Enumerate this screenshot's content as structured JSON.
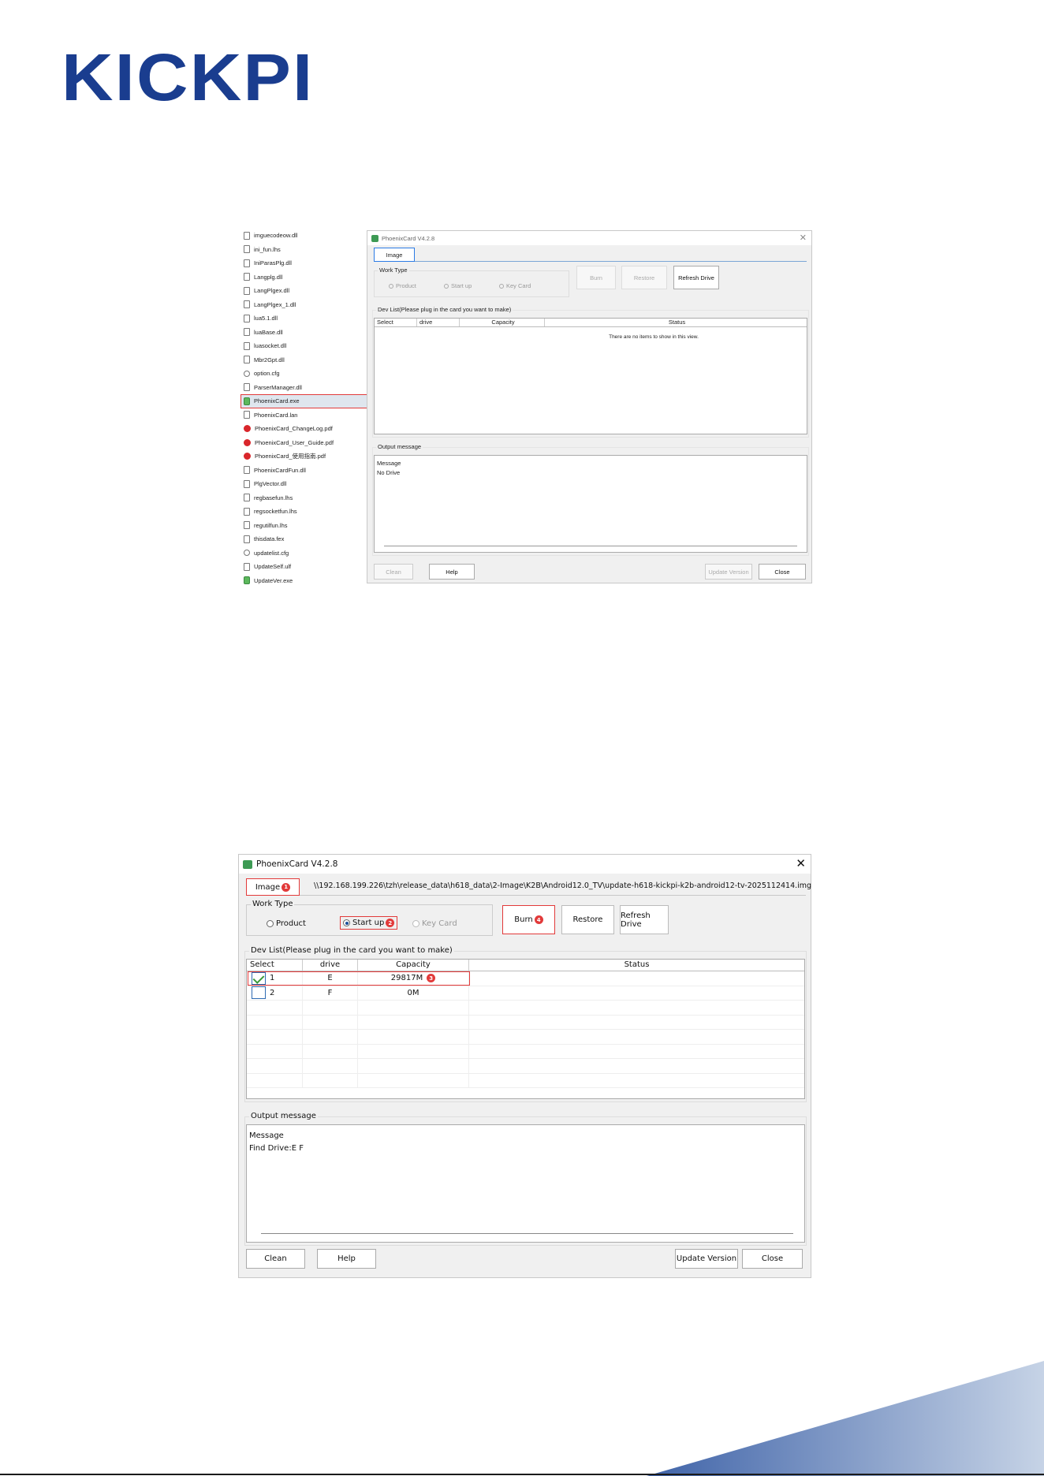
{
  "brand": {
    "logo_text": "KICKPI",
    "color": "#1a3d8f"
  },
  "explorer": {
    "files": [
      {
        "name": "imguecodeow.dll",
        "icon": "dll-file-icon"
      },
      {
        "name": "ini_fun.lhs",
        "icon": "file-icon"
      },
      {
        "name": "IniParasPlg.dll",
        "icon": "dll-file-icon"
      },
      {
        "name": "Langplg.dll",
        "icon": "dll-file-icon"
      },
      {
        "name": "LangPlgex.dll",
        "icon": "dll-file-icon"
      },
      {
        "name": "LangPlgex_1.dll",
        "icon": "dll-file-icon"
      },
      {
        "name": "lua5.1.dll",
        "icon": "dll-file-icon"
      },
      {
        "name": "luaBase.dll",
        "icon": "dll-file-icon"
      },
      {
        "name": "luasocket.dll",
        "icon": "dll-file-icon"
      },
      {
        "name": "Mbr2Gpt.dll",
        "icon": "dll-file-icon"
      },
      {
        "name": "option.cfg",
        "icon": "cfg-file-icon"
      },
      {
        "name": "ParserManager.dll",
        "icon": "dll-file-icon"
      },
      {
        "name": "PhoenixCard.exe",
        "icon": "exe-file-icon"
      },
      {
        "name": "PhoenixCard.lan",
        "icon": "file-icon"
      },
      {
        "name": "PhoenixCard_ChangeLog.pdf",
        "icon": "pdf-file-icon"
      },
      {
        "name": "PhoenixCard_User_Guide.pdf",
        "icon": "pdf-file-icon"
      },
      {
        "name": "PhoenixCard_使用指南.pdf",
        "icon": "pdf-file-icon"
      },
      {
        "name": "PhoenixCardFun.dll",
        "icon": "dll-file-icon"
      },
      {
        "name": "PlgVector.dll",
        "icon": "dll-file-icon"
      },
      {
        "name": "regbasefun.lhs",
        "icon": "file-icon"
      },
      {
        "name": "regsocketfun.lhs",
        "icon": "file-icon"
      },
      {
        "name": "regutilfun.lhs",
        "icon": "file-icon"
      },
      {
        "name": "thisdata.fex",
        "icon": "file-icon"
      },
      {
        "name": "updatelist.cfg",
        "icon": "cfg-file-icon"
      },
      {
        "name": "UpdateSelf.ulf",
        "icon": "file-icon"
      },
      {
        "name": "UpdateVer.exe",
        "icon": "exe-file-icon"
      }
    ],
    "selected_index": 12
  },
  "window1": {
    "title": "PhoenixCard V4.2.8",
    "tab": "Image",
    "work_type_label": "Work Type",
    "radios": [
      "Product",
      "Start up",
      "Key Card"
    ],
    "buttons": {
      "burn": "Burn",
      "restore": "Restore",
      "refresh": "Refresh Drive"
    },
    "devlist_label": "Dev List(Please plug in the card you want to make)",
    "columns": [
      "Select",
      "drive",
      "Capacity",
      "Status"
    ],
    "empty_text": "There are no items to show in this view.",
    "output_label": "Output message",
    "output_lines": [
      "Message",
      "No Drive"
    ],
    "bottom": {
      "clean": "Clean",
      "help": "Help",
      "update": "Update Version",
      "close": "Close"
    }
  },
  "window2": {
    "title": "PhoenixCard V4.2.8",
    "tab": "Image",
    "tab_badge": "1",
    "image_path": "\\\\192.168.199.226\\tzh\\release_data\\h618_data\\2-Image\\K2B\\Android12.0_TV\\update-h618-kickpi-k2b-android12-tv-2025112414.img",
    "work_type_label": "Work Type",
    "radios": [
      "Product",
      "Start up",
      "Key Card"
    ],
    "radio_badge": "2",
    "buttons": {
      "burn": "Burn",
      "burn_badge": "4",
      "restore": "Restore",
      "refresh": "Refresh Drive"
    },
    "devlist_label": "Dev List(Please plug in the card you want to make)",
    "columns": [
      "Select",
      "drive",
      "Capacity",
      "Status"
    ],
    "rows": [
      {
        "index": "1",
        "drive": "E",
        "capacity": "29817M",
        "checked": true,
        "badge": "3"
      },
      {
        "index": "2",
        "drive": "F",
        "capacity": "0M",
        "checked": false
      }
    ],
    "output_label": "Output message",
    "output_lines": [
      "Message",
      "Find Drive:E F"
    ],
    "bottom": {
      "clean": "Clean",
      "help": "Help",
      "update": "Update Version",
      "close": "Close"
    }
  },
  "colors": {
    "highlight": "#e23a3a",
    "accent": "#1a3d8f"
  }
}
